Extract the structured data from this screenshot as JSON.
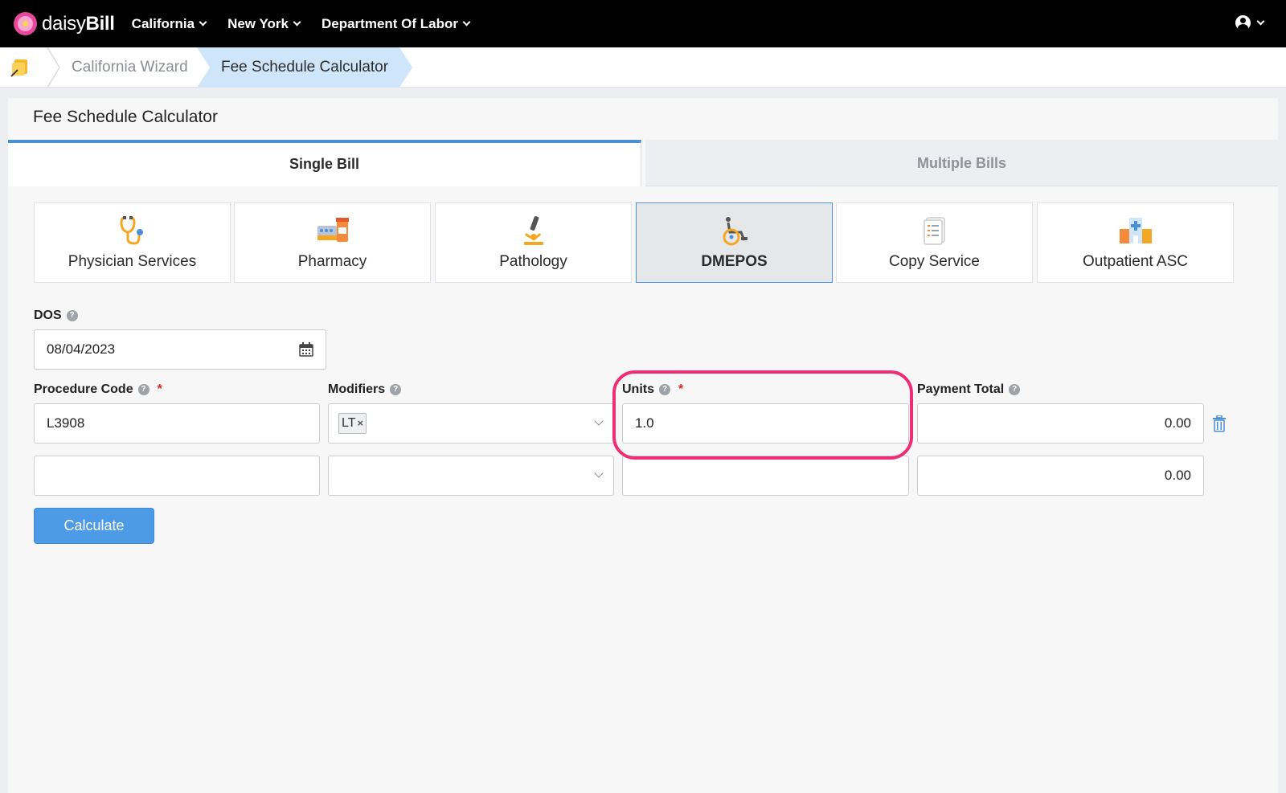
{
  "app": {
    "logo_light": "daisy",
    "logo_bold": "Bill"
  },
  "topnav": {
    "items": [
      {
        "label": "California"
      },
      {
        "label": "New York"
      },
      {
        "label": "Department Of Labor"
      }
    ]
  },
  "breadcrumb": {
    "items": [
      "California Wizard",
      "Fee Schedule Calculator"
    ]
  },
  "page": {
    "title": "Fee Schedule Calculator",
    "tabs": [
      {
        "label": "Single Bill",
        "active": true
      },
      {
        "label": "Multiple Bills",
        "active": false
      }
    ],
    "categories": [
      {
        "label": "Physician Services",
        "icon": "stethoscope-icon"
      },
      {
        "label": "Pharmacy",
        "icon": "pharmacy-icon"
      },
      {
        "label": "Pathology",
        "icon": "microscope-icon"
      },
      {
        "label": "DMEPOS",
        "icon": "wheelchair-icon",
        "active": true
      },
      {
        "label": "Copy Service",
        "icon": "document-icon"
      },
      {
        "label": "Outpatient ASC",
        "icon": "hospital-icon"
      }
    ]
  },
  "form": {
    "dos_label": "DOS",
    "dos_value": "08/04/2023",
    "procedure_label": "Procedure Code",
    "modifiers_label": "Modifiers",
    "units_label": "Units",
    "payment_label": "Payment Total",
    "required_mark": "*",
    "help_mark": "?",
    "rows": [
      {
        "procedure": "L3908",
        "modifier_tag": "LT",
        "modifier_remove": "×",
        "units": "1.0",
        "payment": "0.00"
      },
      {
        "procedure": "",
        "modifier_tag": "",
        "units": "",
        "payment": "0.00"
      }
    ],
    "calculate_label": "Calculate"
  },
  "colors": {
    "accent": "#4a90d9",
    "highlight": "#ee2d74",
    "nav_bg": "#000000"
  }
}
